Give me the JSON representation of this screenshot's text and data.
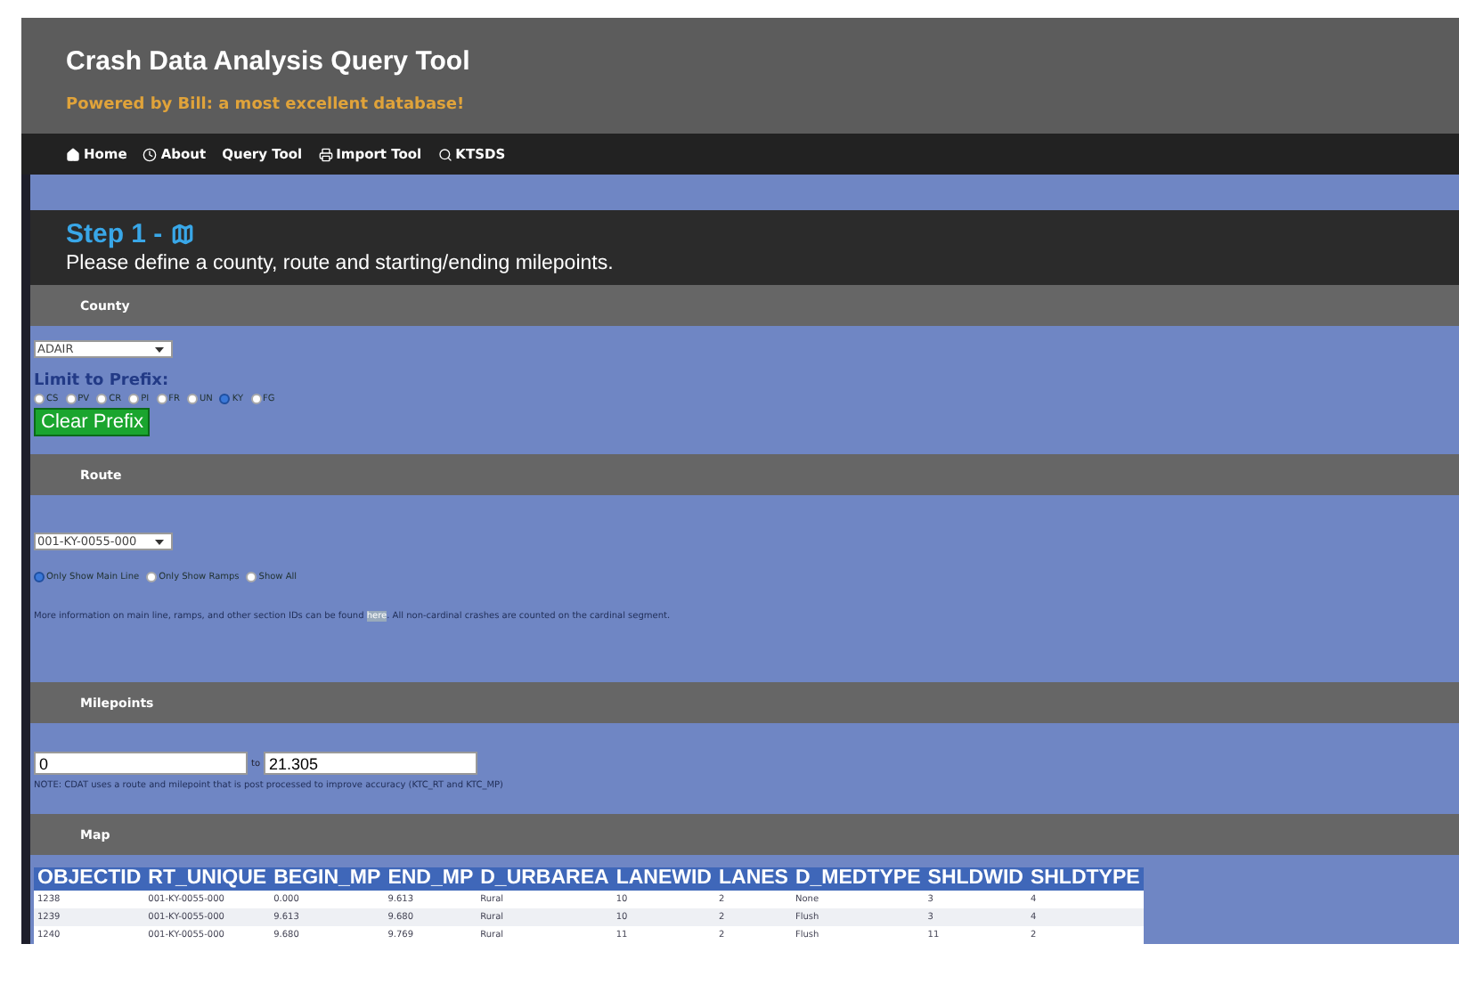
{
  "header": {
    "title": "Crash Data Analysis Query Tool",
    "subtitle": "Powered by Bill: a most excellent database!"
  },
  "nav": [
    {
      "label": "Home",
      "kind": "home"
    },
    {
      "label": "About",
      "kind": "info"
    },
    {
      "label": "Query Tool",
      "kind": "plain"
    },
    {
      "label": "Import Tool",
      "kind": "import"
    },
    {
      "label": "KTSDS",
      "kind": "search"
    }
  ],
  "step": {
    "title": "Step 1 -",
    "description": "Please define a county, route and starting/ending milepoints."
  },
  "county": {
    "heading": "County",
    "value": "ADAIR",
    "prefix_label": "Limit to Prefix:",
    "prefixes": [
      {
        "label": "CS",
        "selected": false
      },
      {
        "label": "PV",
        "selected": false
      },
      {
        "label": "CR",
        "selected": false
      },
      {
        "label": "PI",
        "selected": false
      },
      {
        "label": "FR",
        "selected": false
      },
      {
        "label": "UN",
        "selected": false
      },
      {
        "label": "KY",
        "selected": true
      },
      {
        "label": "FG",
        "selected": false
      }
    ],
    "clear_button": "Clear Prefix"
  },
  "route": {
    "heading": "Route",
    "value": "001-KY-0055-000",
    "options": [
      {
        "label": "Only Show Main Line",
        "selected": true
      },
      {
        "label": "Only Show Ramps",
        "selected": false
      },
      {
        "label": "Show All",
        "selected": false
      }
    ],
    "info_before": "More information on main line, ramps, and other section IDs can be found",
    "info_link": "here",
    "info_after": ". All non-cardinal crashes are counted on the cardinal segment."
  },
  "milepoints": {
    "heading": "Milepoints",
    "start": "0",
    "separator": "to",
    "end": "21.305",
    "note": "NOTE: CDAT uses a route and milepoint that is post processed to improve accuracy (KTC_RT and KTC_MP)"
  },
  "map": {
    "heading": "Map"
  },
  "table": {
    "columns": [
      "OBJECTID",
      "RT_UNIQUE",
      "BEGIN_MP",
      "END_MP",
      "D_URBAREA",
      "LANEWID",
      "LANES",
      "D_MEDTYPE",
      "SHLDWID",
      "SHLDTYPE"
    ],
    "rows": [
      [
        "1238",
        "001-KY-0055-000",
        "0.000",
        "9.613",
        "Rural",
        "10",
        "2",
        "None",
        "3",
        "4"
      ],
      [
        "1239",
        "001-KY-0055-000",
        "9.613",
        "9.680",
        "Rural",
        "10",
        "2",
        "Flush",
        "3",
        "4"
      ],
      [
        "1240",
        "001-KY-0055-000",
        "9.680",
        "9.769",
        "Rural",
        "11",
        "2",
        "Flush",
        "11",
        "2"
      ]
    ]
  }
}
